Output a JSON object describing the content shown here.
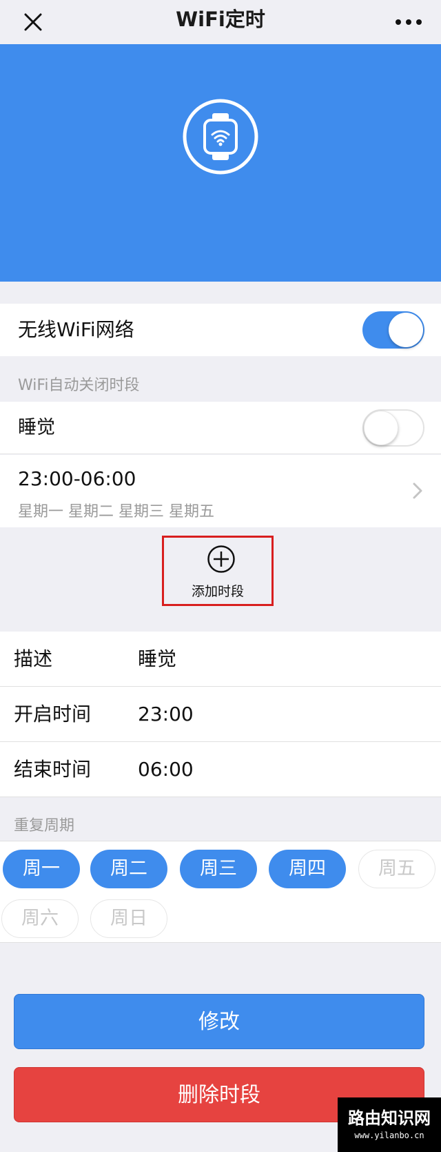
{
  "header": {
    "title": "WiFi定时",
    "close_icon": "close-icon",
    "more_icon": "more-dots-icon"
  },
  "hero": {
    "icon": "watch-wifi-icon",
    "background_color": "#3f8ced"
  },
  "wifi_network": {
    "label": "无线WiFi网络",
    "enabled": true
  },
  "auto_off_section": {
    "label": "WiFi自动关闭时段",
    "schedules": [
      {
        "name": "睡觉",
        "enabled": false,
        "time_range": "23:00-06:00",
        "days": "星期一 星期二 星期三 星期五"
      }
    ],
    "add_label": "添加时段",
    "add_icon": "plus-circle-icon"
  },
  "form": {
    "description_label": "描述",
    "description_value": "睡觉",
    "start_label": "开启时间",
    "start_value": "23:00",
    "end_label": "结束时间",
    "end_value": "06:00"
  },
  "repeat": {
    "label": "重复周期",
    "days": [
      {
        "label": "周一",
        "selected": true
      },
      {
        "label": "周二",
        "selected": true
      },
      {
        "label": "周三",
        "selected": true
      },
      {
        "label": "周四",
        "selected": true
      },
      {
        "label": "周五",
        "selected": false
      },
      {
        "label": "周六",
        "selected": false
      },
      {
        "label": "周日",
        "selected": false
      }
    ]
  },
  "actions": {
    "edit_label": "修改",
    "delete_label": "删除时段",
    "edit_color": "#3f8ced",
    "delete_color": "#e64340"
  },
  "watermark": {
    "main": "路由知识网",
    "sub": "www.yilanbo.cn"
  }
}
